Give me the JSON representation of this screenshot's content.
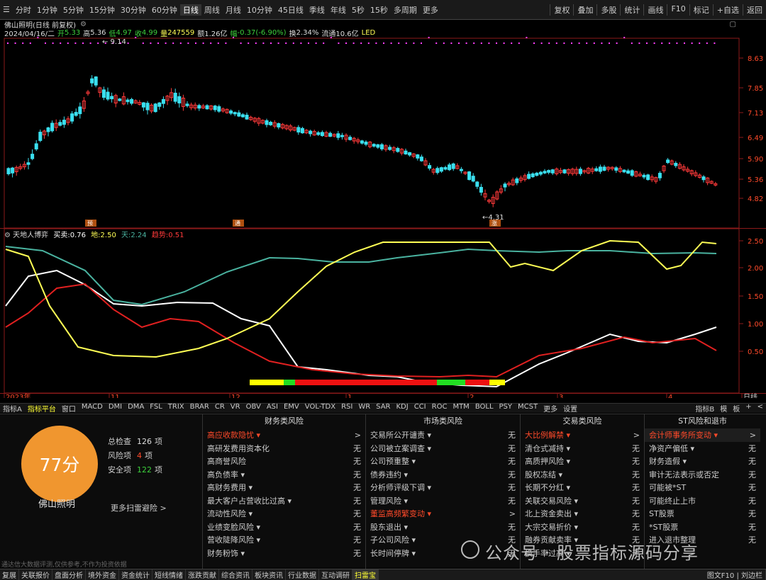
{
  "topbar": {
    "periods": [
      "分时",
      "1分钟",
      "5分钟",
      "15分钟",
      "30分钟",
      "60分钟",
      "日线",
      "周线",
      "月线",
      "10分钟",
      "45日线",
      "季线",
      "年线",
      "5秒",
      "15秒",
      "多周期",
      "更多"
    ],
    "active": "日线",
    "right": [
      "复权",
      "叠加",
      "多股",
      "统计",
      "画线",
      "F10",
      "标记",
      "+自选",
      "返回"
    ]
  },
  "info": {
    "title": "佛山照明(日线 前复权)",
    "date": "2024/04/16/二",
    "open_label": "开",
    "open": "5.33",
    "high_label": "高",
    "high": "5.36",
    "low_label": "低",
    "low": "4.97",
    "close_label": "收",
    "close": "4.99",
    "vol_label": "量",
    "vol": "247559",
    "amt_label": "额",
    "amt": "1.26亿",
    "chg_label": "幅",
    "chg": "-0.37(-6.90%)",
    "turn_label": "换",
    "turn": "2.34%",
    "float_label": "流通",
    "float": "10.6亿",
    "code": "LED"
  },
  "price_axis": [
    "8.63",
    "7.85",
    "7.13",
    "6.49",
    "5.90",
    "5.36",
    "4.82"
  ],
  "price_annot": {
    "max": "9.14",
    "min": "4.31",
    "tags": [
      "预",
      "通",
      "涨"
    ]
  },
  "indicator": {
    "name": "天地人博弈",
    "buy_label": "买卖:",
    "buy": "0.76",
    "di_label": "地:",
    "di": "2.50",
    "tian_label": "天:",
    "tian": "2.24",
    "trend_label": "趋势:",
    "trend": "0.51"
  },
  "ind_axis": [
    "2.50",
    "2.00",
    "1.50",
    "1.00",
    "0.50"
  ],
  "time_axis": [
    "2023年",
    "11",
    "12",
    "1",
    "2",
    "3",
    "4",
    "日线"
  ],
  "indbar": {
    "items": [
      "指标A",
      "指标平台",
      "窗口",
      "MACD",
      "DMI",
      "DMA",
      "FSL",
      "TRIX",
      "BRAR",
      "CR",
      "VR",
      "OBV",
      "ASI",
      "EMV",
      "VOL-TDX",
      "RSI",
      "WR",
      "SAR",
      "KDJ",
      "CCI",
      "ROC",
      "MTM",
      "BOLL",
      "PSY",
      "MCST",
      "更多",
      "设置"
    ],
    "active": "指标平台",
    "right": [
      "指标B",
      "模",
      "板",
      "+",
      "<"
    ]
  },
  "panel": {
    "score": "77分",
    "stock": "佛山照明",
    "stats": [
      {
        "label": "总检查",
        "value": "126",
        "unit": "项",
        "color": "#dddddd"
      },
      {
        "label": "风险项",
        "value": "4",
        "unit": "项",
        "color": "#ff4a2a"
      },
      {
        "label": "安全项",
        "value": "122",
        "unit": "项",
        "color": "#3cd13c"
      }
    ],
    "more": "更多扫雷避险 >",
    "disclaimer": "通达信大数据评测,仅供参考,不作为投资依据",
    "columns": [
      {
        "title": "财务类风险",
        "items": [
          {
            "k": "高应收款隐忧 ▾",
            "v": ">",
            "red": true
          },
          {
            "k": "高研发费用资本化",
            "v": "无"
          },
          {
            "k": "高商誉风险",
            "v": "无"
          },
          {
            "k": "高负债率 ▾",
            "v": "无"
          },
          {
            "k": "高财务费用 ▾",
            "v": "无"
          },
          {
            "k": "最大客户占营收比过高 ▾",
            "v": "无"
          },
          {
            "k": "流动性风险 ▾",
            "v": "无"
          },
          {
            "k": "业绩变脸风险 ▾",
            "v": "无"
          },
          {
            "k": "营收陡降风险 ▾",
            "v": "无"
          },
          {
            "k": "财务粉饰 ▾",
            "v": "无"
          }
        ]
      },
      {
        "title": "市场类风险",
        "items": [
          {
            "k": "交易所公开谴责 ▾",
            "v": "无"
          },
          {
            "k": "公司被立案调查 ▾",
            "v": "无"
          },
          {
            "k": "公司预重整 ▾",
            "v": "无"
          },
          {
            "k": "债券违约 ▾",
            "v": "无"
          },
          {
            "k": "分析师评级下调 ▾",
            "v": "无"
          },
          {
            "k": "管理风险 ▾",
            "v": "无"
          },
          {
            "k": "董监高频繁变动 ▾",
            "v": ">",
            "red": true
          },
          {
            "k": "股东退出 ▾",
            "v": "无"
          },
          {
            "k": "子公司风险 ▾",
            "v": "无"
          },
          {
            "k": "长时间停牌 ▾",
            "v": "无"
          }
        ]
      },
      {
        "title": "交易类风险",
        "items": [
          {
            "k": "大比例解禁 ▾",
            "v": ">",
            "red": true
          },
          {
            "k": "清仓式减持 ▾",
            "v": "无"
          },
          {
            "k": "高质押风险 ▾",
            "v": "无"
          },
          {
            "k": "股权冻结 ▾",
            "v": "无"
          },
          {
            "k": "长期不分红 ▾",
            "v": "无"
          },
          {
            "k": "关联交易风险 ▾",
            "v": "无"
          },
          {
            "k": "北上资金卖出 ▾",
            "v": "无"
          },
          {
            "k": "大宗交易折价 ▾",
            "v": "无"
          },
          {
            "k": "融券贡献卖率 ▾",
            "v": "无"
          },
          {
            "k": "换手率过高 ▾",
            "v": "无"
          }
        ]
      },
      {
        "title": "ST风险和退市",
        "items": [
          {
            "k": "会计师事务所变动 ▾",
            "v": ">",
            "red": true,
            "hl": true
          },
          {
            "k": "净资产偏低 ▾",
            "v": "无"
          },
          {
            "k": "财务造假 ▾",
            "v": "无"
          },
          {
            "k": "审计无法表示或否定",
            "v": "无"
          },
          {
            "k": "可能被*ST",
            "v": "无"
          },
          {
            "k": "可能终止上市",
            "v": "无"
          },
          {
            "k": "ST股票",
            "v": "无"
          },
          {
            "k": "*ST股票",
            "v": "无"
          },
          {
            "k": "进入退市整理",
            "v": "无"
          }
        ]
      }
    ]
  },
  "watermark": "公众号 · 股票指标源码分享",
  "botbar": [
    "复展",
    "关联报价",
    "盘面分析",
    "境外资金",
    "资金统计",
    "短线情绪",
    "涨跌贡献",
    "综合资讯",
    "板块资讯",
    "行业数据",
    "互动调研",
    "扫雷宝"
  ],
  "botbar_right": "图文F10 | 刘边栏",
  "colors": {
    "up": "#ff3a3a",
    "down": "#3ae0f0",
    "yellow": "#ffff55",
    "white": "#ffffff",
    "green": "#4ab3a0",
    "red": "#e02020"
  }
}
